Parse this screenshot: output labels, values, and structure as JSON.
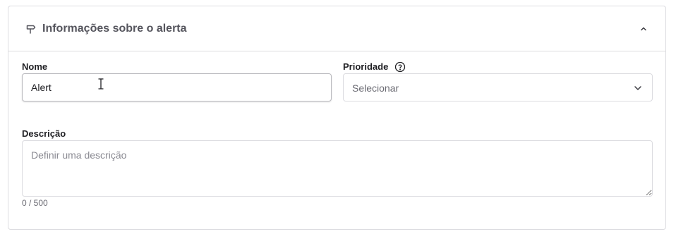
{
  "section": {
    "title": "Informações sobre o alerta",
    "header_icon": "signpost-icon",
    "collapse_icon": "chevron-up-icon"
  },
  "fields": {
    "name": {
      "label": "Nome",
      "value": "Alert"
    },
    "priority": {
      "label": "Prioridade",
      "help_icon": "help-circle-icon",
      "selected": "Selecionar",
      "chevron_icon": "chevron-down-icon"
    },
    "description": {
      "label": "Descrição",
      "placeholder": "Definir uma descrição",
      "counter": "0 / 500"
    }
  },
  "colors": {
    "border": "#dcdce0",
    "title_text": "#55555d",
    "label_text": "#1f1f23",
    "placeholder_text": "#8a8a92"
  }
}
